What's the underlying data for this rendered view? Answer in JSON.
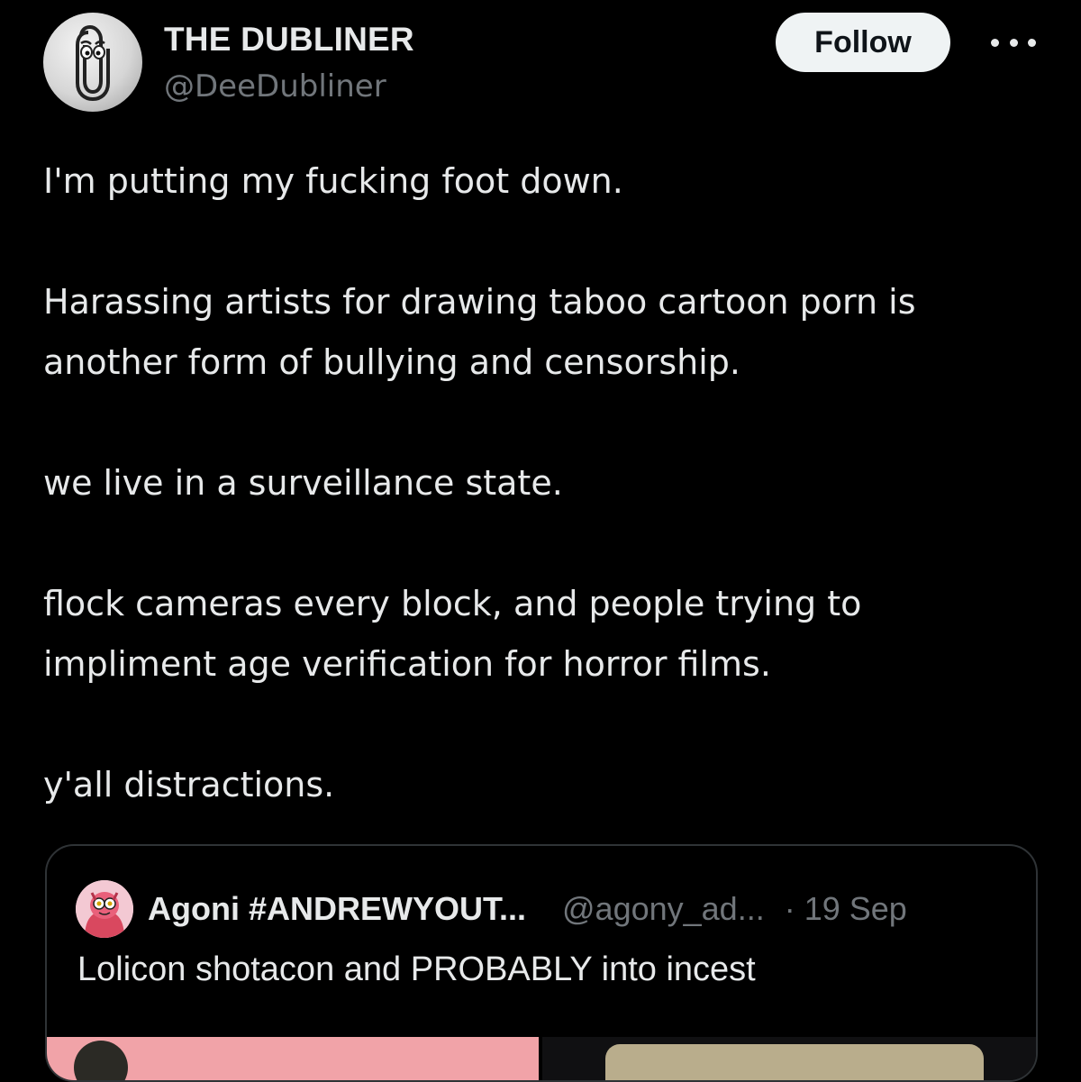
{
  "author": {
    "display_name": "THE DUBLINER",
    "handle": "@DeeDubliner",
    "avatar_icon": "paperclip-icon"
  },
  "actions": {
    "follow_label": "Follow",
    "more_icon": "more-horizontal-icon"
  },
  "tweet": {
    "paragraphs": [
      "I'm putting my fucking foot down.",
      "Harassing artists for drawing taboo cartoon porn is",
      "another form of bullying and censorship.",
      "we live in a surveillance state.",
      "flock cameras every block, and people trying to",
      "impliment age verification for horror films.",
      "y'all distractions."
    ]
  },
  "quoted_tweet": {
    "display_name": "Agoni #ANDREWYOUT...",
    "handle": "@agony_ad...",
    "time": "· 19 Sep",
    "text": "Lolicon shotacon and PROBABLY into incest"
  },
  "colors": {
    "background": "#000000",
    "text_primary": "#e7e9ea",
    "text_secondary": "#71767b",
    "follow_bg": "#eff3f4",
    "border": "#2f3336"
  }
}
